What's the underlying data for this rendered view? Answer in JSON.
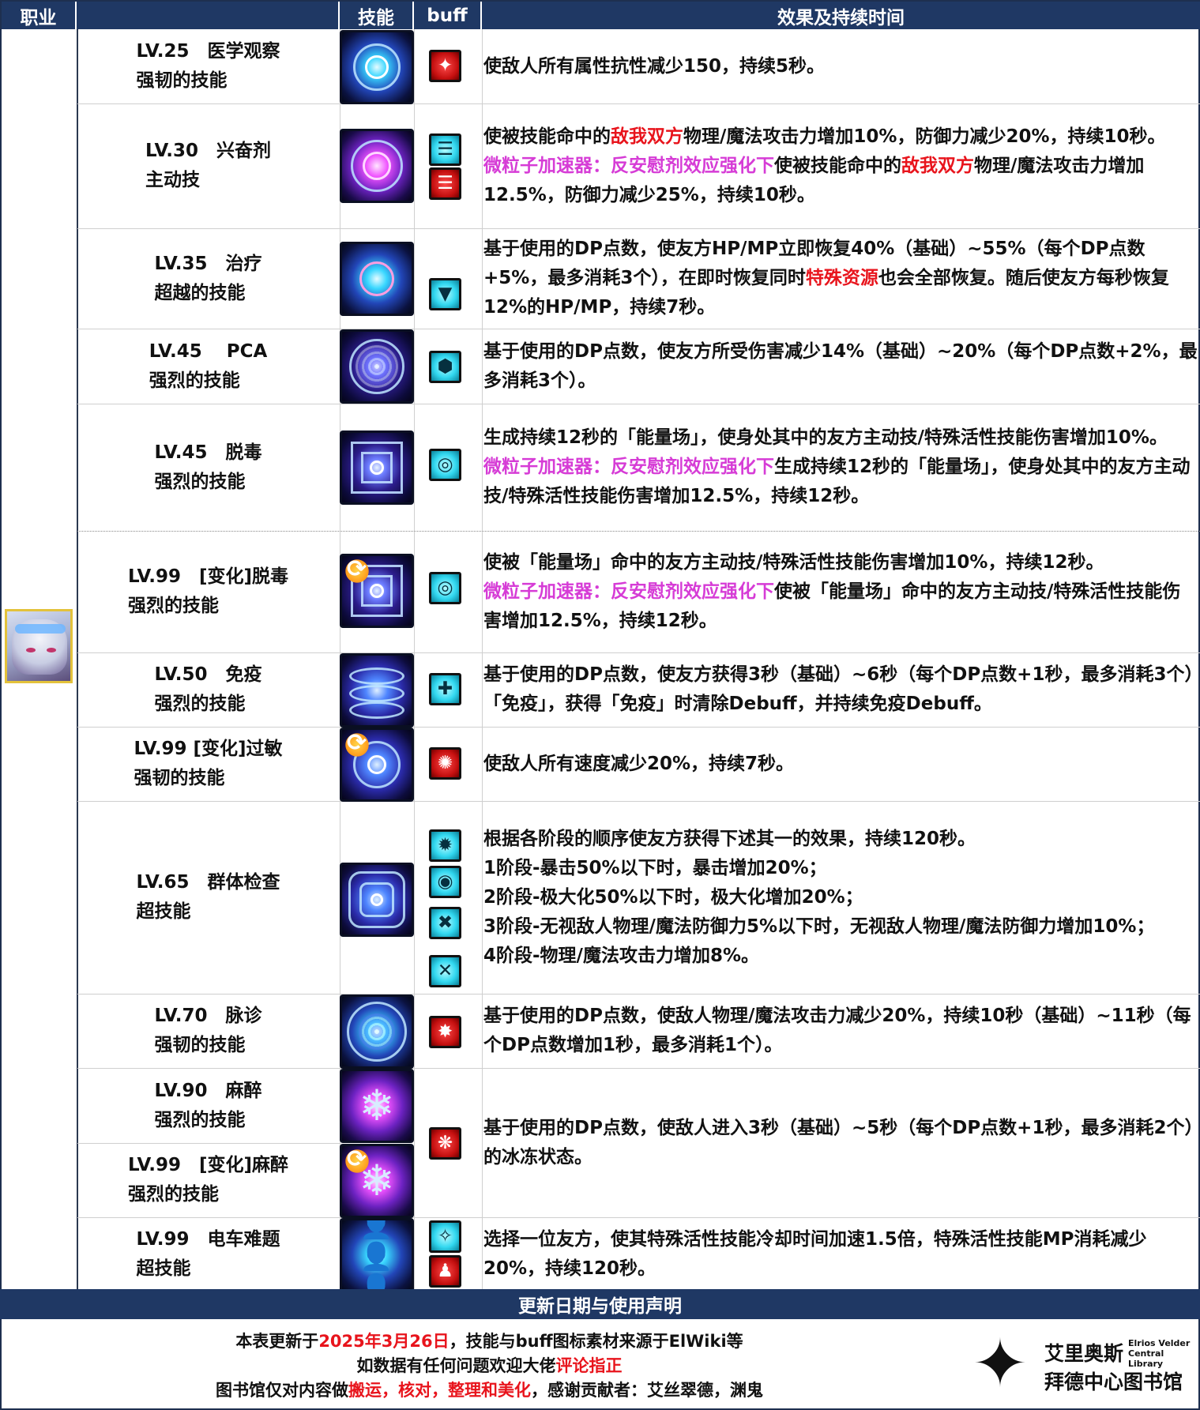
{
  "header": {
    "job": "职业",
    "skill": "技能",
    "buff": "buff",
    "effect": "效果及持续时间"
  },
  "rows": [
    {
      "name": "LV.25　医学观察\n强韧的技能",
      "desc": [
        [
          {
            "t": "使敌人所有属性抗性减少150，持续5秒。"
          }
        ]
      ]
    },
    {
      "name": "LV.30　兴奋剂\n主动技",
      "desc": [
        [
          {
            "t": "使被技能命中的"
          },
          {
            "t": "敌我双方",
            "c": "red"
          },
          {
            "t": "物理/魔法攻击力增加10%，防御力减少20%，持续10秒。"
          }
        ],
        [
          {
            "t": "微粒子加速器：反安慰剂效应强化下",
            "c": "mag"
          },
          {
            "t": "使被技能命中的"
          },
          {
            "t": "敌我双方",
            "c": "red"
          },
          {
            "t": "物理/魔法攻击力增加12.5%，防御力减少25%，持续10秒。"
          }
        ]
      ]
    },
    {
      "name": "LV.35　治疗\n超越的技能",
      "desc": [
        [
          {
            "t": "基于使用的DP点数，使友方HP/MP立即恢复40%（基础）~55%（每个DP点数+5%，最多消耗3个），在即时恢复同时"
          },
          {
            "t": "特殊资源",
            "c": "red"
          },
          {
            "t": "也会全部恢复。随后使友方每秒恢复12%的HP/MP，持续7秒。"
          }
        ]
      ]
    },
    {
      "name": "LV.45　 PCA\n强烈的技能",
      "desc": [
        [
          {
            "t": "基于使用的DP点数，使友方所受伤害减少14%（基础）~20%（每个DP点数+2%，最多消耗3个）。"
          }
        ]
      ]
    },
    {
      "name": "LV.45　脱毒\n强烈的技能",
      "desc": [
        [
          {
            "t": "生成持续12秒的「能量场」，使身处其中的友方主动技/特殊活性技能伤害增加10%。"
          }
        ],
        [
          {
            "t": "微粒子加速器：反安慰剂效应强化下",
            "c": "mag"
          },
          {
            "t": "生成持续12秒的「能量场」，使身处其中的友方主动技/特殊活性技能伤害增加12.5%，持续12秒。"
          }
        ]
      ]
    },
    {
      "name": "LV.99　[变化]脱毒\n强烈的技能",
      "desc": [
        [
          {
            "t": "使被「能量场」命中的友方主动技/特殊活性技能伤害增加10%，持续12秒。"
          }
        ],
        [
          {
            "t": "微粒子加速器：反安慰剂效应强化下",
            "c": "mag"
          },
          {
            "t": "使被「能量场」命中的友方主动技/特殊活性技能伤害增加12.5%，持续12秒。"
          }
        ]
      ]
    },
    {
      "name": "LV.50　免疫\n强烈的技能",
      "desc": [
        [
          {
            "t": "基于使用的DP点数，使友方获得3秒（基础）~6秒（每个DP点数+1秒，最多消耗3个）「免疫」，获得「免疫」时清除Debuff，并持续免疫Debuff。"
          }
        ]
      ]
    },
    {
      "name": "LV.99 [变化]过敏\n强韧的技能",
      "desc": [
        [
          {
            "t": "使敌人所有速度减少20%，持续7秒。"
          }
        ]
      ]
    },
    {
      "name": "LV.65　群体检查\n超技能",
      "desc": [
        [
          {
            "t": "根据各阶段的顺序使友方获得下述其一的效果，持续120秒。"
          }
        ],
        [
          {
            "t": "1阶段-暴击50%以下时，暴击增加20%；"
          }
        ],
        [
          {
            "t": "2阶段-极大化50%以下时，极大化增加20%；"
          }
        ],
        [
          {
            "t": "3阶段-无视敌人物理/魔法防御力5%以下时，无视敌人物理/魔法防御力增加10%；"
          }
        ],
        [
          {
            "t": "4阶段-物理/魔法攻击力增加8%。"
          }
        ]
      ]
    },
    {
      "name": "LV.70　脉诊\n强韧的技能",
      "desc": [
        [
          {
            "t": "基于使用的DP点数，使敌人物理/魔法攻击力减少20%，持续10秒（基础）~11秒（每个DP点数增加1秒，最多消耗1个）。"
          }
        ]
      ]
    },
    {
      "name": "LV.90　麻醉\n强烈的技能",
      "desc": []
    },
    {
      "name": "LV.99　[变化]麻醉\n强烈的技能",
      "desc": [
        [
          {
            "t": "基于使用的DP点数，使敌人进入3秒（基础）~5秒（每个DP点数+1秒，最多消耗2个）的冰冻状态。"
          }
        ]
      ]
    },
    {
      "name": "LV.99　电车难题\n超技能",
      "desc": [
        [
          {
            "t": "选择一位友方，使其特殊活性技能冷却时间加速1.5倍，特殊活性技能MP消耗减少20%，持续120秒。"
          }
        ]
      ]
    }
  ],
  "icons": {
    "skills": [
      "medical-observation-icon",
      "stimulant-icon",
      "heal-icon",
      "pca-icon",
      "detox-icon",
      "detox-changed-icon",
      "immunity-icon",
      "allergy-icon",
      "group-check-icon",
      "pulse-icon",
      "anesthesia-icon",
      "anesthesia-changed-icon",
      "trolley-problem-icon"
    ],
    "cycle": "change-cycle-icon"
  },
  "colors": {
    "header": "#1f3864",
    "red": "#e8141c",
    "magenta": "#d63cd6",
    "avatar_border": "#e3c23b"
  },
  "footer": {
    "title": "更新日期与使用声明",
    "line1": [
      {
        "t": "本表更新于"
      },
      {
        "t": "2025年3月26日",
        "c": "red"
      },
      {
        "t": "，技能与buff图标素材来源于ElWiki等"
      }
    ],
    "line2": [
      {
        "t": "如数据有任何问题欢迎大佬"
      },
      {
        "t": "评论指正",
        "c": "red"
      }
    ],
    "line3": [
      {
        "t": "图书馆仅对内容做"
      },
      {
        "t": "搬运，核对，整理和美化",
        "c": "red"
      },
      {
        "t": "，感谢贡献者：艾丝翠德，渊鬼"
      }
    ],
    "logo_cn1": "艾里奥斯",
    "logo_en": "Elrios Velder Central Library",
    "logo_cn2": "拜德中心图书馆"
  }
}
